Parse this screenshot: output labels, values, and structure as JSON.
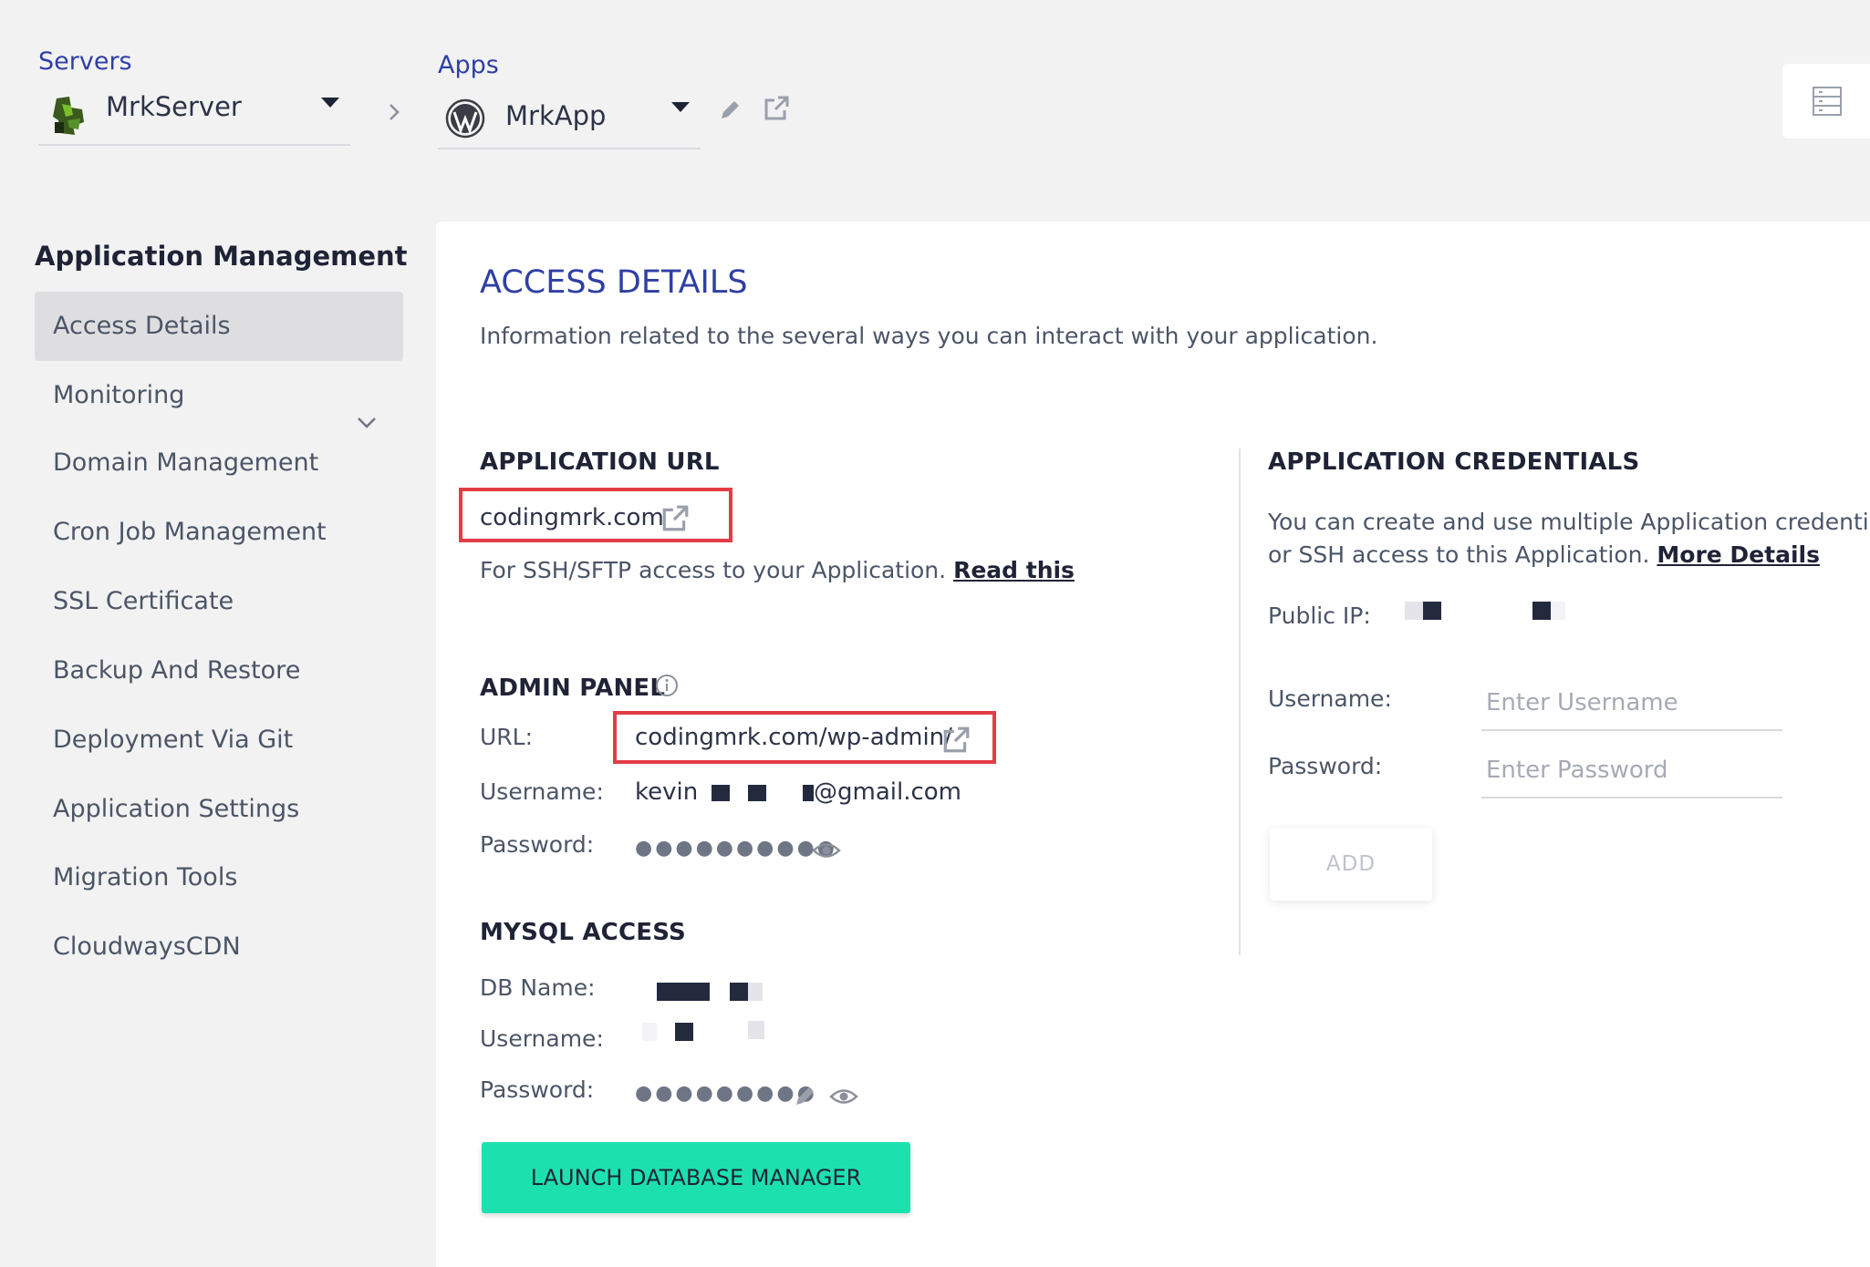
{
  "header": {
    "servers_label": "Servers",
    "server_name": "MrkServer",
    "apps_label": "Apps",
    "app_name": "MrkApp"
  },
  "sidebar": {
    "heading": "Application Management",
    "items": [
      {
        "label": "Access Details",
        "active": true
      },
      {
        "label": "Monitoring"
      },
      {
        "label": "Domain Management"
      },
      {
        "label": "Cron Job Management"
      },
      {
        "label": "SSL Certificate"
      },
      {
        "label": "Backup And Restore"
      },
      {
        "label": "Deployment Via Git"
      },
      {
        "label": "Application Settings"
      },
      {
        "label": "Migration Tools"
      },
      {
        "label": "CloudwaysCDN"
      }
    ]
  },
  "access": {
    "title": "ACCESS DETAILS",
    "subtitle": "Information related to the several ways you can interact with your application.",
    "app_url": {
      "heading": "APPLICATION URL",
      "url": "codingmrk.com",
      "ssh_text": "For SSH/SFTP access to your Application.",
      "ssh_link": "Read this"
    },
    "admin_panel": {
      "heading": "ADMIN PANEL",
      "url_label": "URL:",
      "url": "codingmrk.com/wp-admin/",
      "username_label": "Username:",
      "username_prefix": "kevin",
      "username_suffix": "@gmail.com",
      "password_label": "Password:",
      "password_mask": "●●●●●●●●●●"
    },
    "mysql": {
      "heading": "MYSQL ACCESS",
      "db_name_label": "DB Name:",
      "username_label": "Username:",
      "password_label": "Password:",
      "password_mask": "●●●●●●●●●",
      "launch_label": "LAUNCH DATABASE MANAGER"
    },
    "credentials": {
      "heading": "APPLICATION CREDENTIALS",
      "desc_line1": "You can create and use multiple Application credentia",
      "desc_line2": "or SSH access to this Application.",
      "more_link": "More Details",
      "public_ip_label": "Public IP:",
      "username_label": "Username:",
      "username_placeholder": "Enter Username",
      "password_label": "Password:",
      "password_placeholder": "Enter Password",
      "add_label": "ADD"
    }
  },
  "colors": {
    "accent_blue": "#2f3fa4",
    "highlight_red": "#e23c45",
    "launch_green": "#1ce1ae"
  }
}
